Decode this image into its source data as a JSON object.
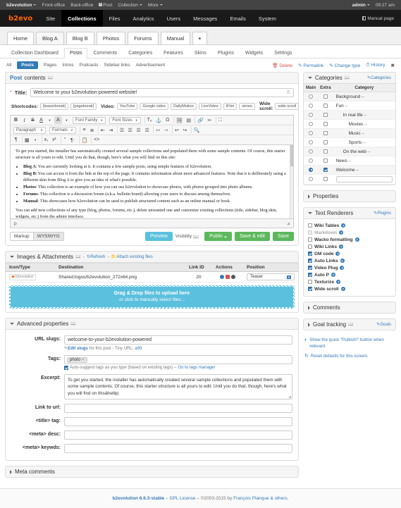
{
  "evobar": {
    "brand": "b2evolution",
    "items": [
      "Front-office",
      "Back-office"
    ],
    "post_label": "Post",
    "collection_label": "Collection",
    "more_label": "More",
    "user": "admin",
    "time": "09:27 am"
  },
  "mainmenu": {
    "logo": "b2evo",
    "items": [
      {
        "label": "Site",
        "active": false
      },
      {
        "label": "Collections",
        "active": true
      },
      {
        "label": "Files",
        "active": false
      },
      {
        "label": "Analytics",
        "active": false
      },
      {
        "label": "Users",
        "active": false
      },
      {
        "label": "Messages",
        "active": false
      },
      {
        "label": "Emails",
        "active": false
      },
      {
        "label": "System",
        "active": false
      }
    ],
    "manual_page": "Manual page"
  },
  "collection_tabs": [
    {
      "label": "Home",
      "selected": false
    },
    {
      "label": "Blog A",
      "selected": true
    },
    {
      "label": "Blog B",
      "selected": false
    },
    {
      "label": "Photos",
      "selected": false
    },
    {
      "label": "Forums",
      "selected": false
    },
    {
      "label": "Manual",
      "selected": false
    }
  ],
  "collection_tab_add": "+",
  "subtabs": [
    {
      "label": "Collection Dashboard",
      "selected": false
    },
    {
      "label": "Posts",
      "selected": true
    },
    {
      "label": "Comments",
      "selected": false
    },
    {
      "label": "Categories",
      "selected": false
    },
    {
      "label": "Features",
      "selected": false
    },
    {
      "label": "Skins",
      "selected": false
    },
    {
      "label": "Plugins",
      "selected": false
    },
    {
      "label": "Widgets",
      "selected": false
    },
    {
      "label": "Settings",
      "selected": false
    }
  ],
  "filters": [
    {
      "label": "All",
      "selected": false
    },
    {
      "label": "Posts",
      "selected": true
    },
    {
      "label": "Pages",
      "selected": false
    },
    {
      "label": "Intros",
      "selected": false
    },
    {
      "label": "Podcasts",
      "selected": false
    },
    {
      "label": "Sidebar links",
      "selected": false
    },
    {
      "label": "Advertisement",
      "selected": false
    }
  ],
  "post_actions": {
    "delete": "Delete",
    "permalink": "Permalink",
    "change_type": "Change type",
    "history": "History",
    "close": "✖"
  },
  "post_contents": {
    "panel_title_strong": "Post",
    "panel_title_rest": "contents",
    "title_label": "Title:",
    "title_value": "Welcome to your b2evolution-powered website!",
    "shortcodes_label": "Shortcodes:",
    "shortcodes": [
      "[teaserbreak]",
      "[pagebreak]"
    ],
    "video_label": "Video:",
    "video_codes": [
      "YouTube",
      "Google video",
      "DailyMotion",
      "LiveVideo",
      "iFilm",
      "vimeo"
    ],
    "widescroll_label": "Wide scroll:",
    "widescroll_codes": [
      "wide scroll"
    ],
    "toolbar_row1": [
      "B",
      "I",
      "S",
      "A",
      "A",
      "Font Family",
      "Font Sizes",
      "Tx",
      "⚓",
      "Ω",
      "▣",
      "▤",
      "⚭",
      "✂",
      "⤢"
    ],
    "font_family_label": "Font Family",
    "font_sizes_label": "Font Sizes",
    "paragraph_label": "Paragraph",
    "formats_label": "Formats",
    "body_paragraph_1": "To get you started, the installer has automatically created several sample collections and populated them with some sample contents. Of course, this starter structure is all yours to edit. Until you do that, though, here's what you will find on this site:",
    "body_items": [
      {
        "term": "Blog A",
        "text": ": You are currently looking at it. It contains a few sample posts, using simple features of b2evolution."
      },
      {
        "term": "Blog B",
        "text": ": You can access it from the link at the top of the page. It contains information about more advanced features. Note that it is deliberately using a different skin from Blog A to give you an idea of what's possible."
      },
      {
        "term": "Photos",
        "text": ": This collection is an example of how you can use b2evolution to showcase photos, with photos grouped into photo albums."
      },
      {
        "term": "Forums",
        "text": ": This collection is a discussion forum (a.k.a. bulletin board) allowing your users to discuss among themselves."
      },
      {
        "term": "Manual",
        "text": ": This showcases how b2evolution can be used to publish structured content such as an online manual or book."
      }
    ],
    "body_paragraph_2": "You can add new collections of any type (blog, photos, forums, etc.), delete unwanted one and customize existing collections (title, sidebar, blog skin, widgets, etc.) from the admin interface.",
    "status_path": "p",
    "markup_label": "Markup",
    "wysiwyg_label": "WYSIWYG",
    "preview_label": "Preview",
    "visibility_label": "Visibility",
    "visibility_value": "Public",
    "save_edit_label": "Save & edit",
    "save_label": "Save"
  },
  "attachments": {
    "panel_title": "Images & Attachments",
    "refresh_label": "Refresh",
    "attach_label": "Attach existing files",
    "columns": [
      "Icon/Type",
      "Destination",
      "Link ID",
      "Actions",
      "Position"
    ],
    "rows": [
      {
        "icon_text": "b2evolution",
        "destination": "Shared:logos/b2evolution_272x64.png",
        "link_id": "20",
        "position": "Teaser"
      }
    ],
    "dropzone_line1": "Drag & Drop files to upload here",
    "dropzone_line2": "or click to manually select files..."
  },
  "advanced": {
    "panel_title": "Advanced properties",
    "url_slugs_label": "URL slugs:",
    "url_slugs_value": "welcome-to-your-b2evolution-powered",
    "edit_slugs_label": "Edit slugs",
    "slug_hint": "for this post - Tiny URL:",
    "tiny_url": "a99",
    "tags_label": "Tags:",
    "tag_value": "photo",
    "tag_remove": "×",
    "autosuggest_label": "Auto-suggest tags as you type (based on existing tags)",
    "autosuggest_sep": "–",
    "tags_manager_link": "Go to tags manager",
    "excerpt_label": "Excerpt:",
    "excerpt_value": "To get you started, the installer has automatically created several sample collections and populated them with some sample contents. Of course, this starter structure is all yours to edit. Until you do that, though, here's what you will find on this&hellip;",
    "link_to_url_label": "Link to url:",
    "link_to_url_value": "",
    "title_tag_label": "<title> tag:",
    "title_tag_value": "",
    "meta_desc_label": "<meta> desc:",
    "meta_desc_value": "",
    "meta_keywds_label": "<meta> keywds:",
    "meta_keywds_value": ""
  },
  "meta_comments": {
    "panel_title": "Meta comments"
  },
  "sidebar": {
    "categories": {
      "panel_title": "Categories",
      "head_action": "Categories",
      "columns": [
        "Main",
        "Extra",
        "Category"
      ],
      "rows": [
        {
          "name": "Background",
          "indent": 0,
          "main": false,
          "extra": false
        },
        {
          "name": "Fun",
          "indent": 0,
          "main": false,
          "extra": false
        },
        {
          "name": "In real life",
          "indent": 1,
          "main": false,
          "extra": false
        },
        {
          "name": "Movies",
          "indent": 2,
          "main": false,
          "extra": false
        },
        {
          "name": "Music",
          "indent": 2,
          "main": false,
          "extra": false
        },
        {
          "name": "Sports",
          "indent": 2,
          "main": false,
          "extra": false
        },
        {
          "name": "On the web",
          "indent": 1,
          "main": false,
          "extra": false
        },
        {
          "name": "News",
          "indent": 0,
          "main": false,
          "extra": false
        },
        {
          "name": "Welcome",
          "indent": 0,
          "main": true,
          "extra": true
        }
      ],
      "new_category_value": ""
    },
    "properties": {
      "panel_title": "Properties"
    },
    "text_renderers": {
      "panel_title": "Text Renderers",
      "head_action": "Plugins",
      "items": [
        {
          "label": "Wiki Tables",
          "checked": false,
          "disabled": false
        },
        {
          "label": "Markdown",
          "checked": false,
          "disabled": true
        },
        {
          "label": "Wacko formatting",
          "checked": false,
          "disabled": false
        },
        {
          "label": "Wiki Links",
          "checked": false,
          "disabled": false
        },
        {
          "label": "GM code",
          "checked": true,
          "disabled": false
        },
        {
          "label": "Auto Links",
          "checked": true,
          "disabled": false
        },
        {
          "label": "Video Plug",
          "checked": true,
          "disabled": false
        },
        {
          "label": "Auto P",
          "checked": true,
          "disabled": false
        },
        {
          "label": "Texturize",
          "checked": false,
          "disabled": false
        },
        {
          "label": "Wide scroll",
          "checked": true,
          "disabled": false
        }
      ]
    },
    "comments": {
      "panel_title": "Comments"
    },
    "goal_tracking": {
      "panel_title": "Goal tracking",
      "head_action": "Goals"
    },
    "notes": [
      "Show the quick \"Publish!\" button when relevant.",
      "Reset defaults for this screen."
    ]
  },
  "footer": {
    "version": "b2evolution 6.6.3-stable",
    "sep1": "–",
    "license": "GPL License",
    "sep2": "–",
    "copyright": "©2003-2015 by",
    "author": "François Planque & others."
  }
}
